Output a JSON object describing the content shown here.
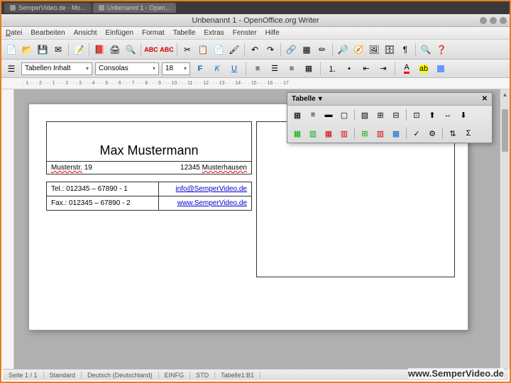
{
  "browser": {
    "tab1": "SemperVideo.de - Mo...",
    "tab2": "Unbenannt 1 - Open..."
  },
  "window": {
    "title": "Unbenannt 1 - OpenOffice.org Writer"
  },
  "menu": {
    "datei": "Datei",
    "bearbeiten": "Bearbeiten",
    "ansicht": "Ansicht",
    "einfuegen": "Einfügen",
    "format": "Format",
    "tabelle": "Tabelle",
    "extras": "Extras",
    "fenster": "Fenster",
    "hilfe": "Hilfe"
  },
  "format": {
    "style": "Tabellen Inhalt",
    "font": "Consolas",
    "size": "18",
    "bold": "F",
    "italic": "K",
    "underline": "U"
  },
  "card": {
    "name": "Max Mustermann",
    "street": "Musterstr.",
    "street_no": "19",
    "zip": "12345",
    "city": "Musterhausen",
    "tel_label": "Tel.: 012345 – 67890 - 1",
    "fax_label": "Fax.: 012345 – 67890 - 2",
    "email": "info@SemperVideo.de",
    "web": "www.SemperVideo.de"
  },
  "panel": {
    "title": "Tabelle"
  },
  "status": {
    "page": "Seite 1 / 1",
    "style": "Standard",
    "lang": "Deutsch (Deutschland)",
    "ins": "EINFG",
    "std": "STD",
    "cell": "Tabelle1:B1"
  },
  "watermark": "www.SemperVideo.de",
  "ruler": {
    "marks": [
      "1",
      "2",
      "1",
      "2",
      "3",
      "4",
      "5",
      "6",
      "7",
      "8",
      "9",
      "10",
      "11",
      "12",
      "13",
      "14",
      "15",
      "16",
      "17"
    ]
  }
}
